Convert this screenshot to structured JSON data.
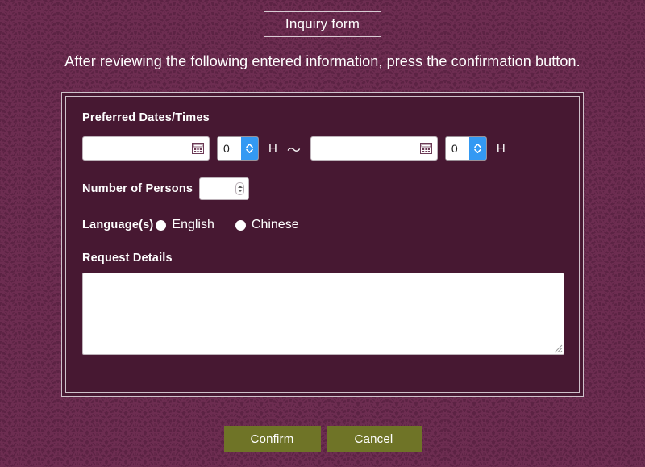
{
  "page": {
    "title": "Inquiry form",
    "instruction": "After reviewing the following entered information, press the confirmation button."
  },
  "form": {
    "fields": {
      "preferred_dates": {
        "label": "Preferred Dates/Times",
        "start_date_value": "",
        "start_date_placeholder": "",
        "start_hour_value": "0",
        "start_hour_unit": "H",
        "separator": "〜",
        "end_date_value": "",
        "end_date_placeholder": "",
        "end_hour_value": "0",
        "end_hour_unit": "H",
        "calendar_icon": "calendar-icon",
        "spinner_icon": "spinner-up-down-icon"
      },
      "number_of_persons": {
        "label": "Number of Persons",
        "value": "",
        "placeholder": "",
        "spinner_icon": "spinner-up-down-icon"
      },
      "languages": {
        "label": "Language(s)",
        "options": [
          {
            "label": "English",
            "selected": false
          },
          {
            "label": "Chinese",
            "selected": false
          }
        ]
      },
      "request_details": {
        "label": "Request Details",
        "value": "",
        "placeholder": "",
        "resize_handle_icon": "resize-grip-icon"
      }
    }
  },
  "footer": {
    "confirm_label": "Confirm",
    "cancel_label": "Cancel"
  },
  "colors": {
    "background": "#5c2344",
    "pattern_line": "#6d2d51",
    "panel": "#471832",
    "panel_border": "#cfc2cb",
    "button": "#6f7427",
    "spinner_accent": "#3399f3",
    "text": "#ffffff"
  }
}
